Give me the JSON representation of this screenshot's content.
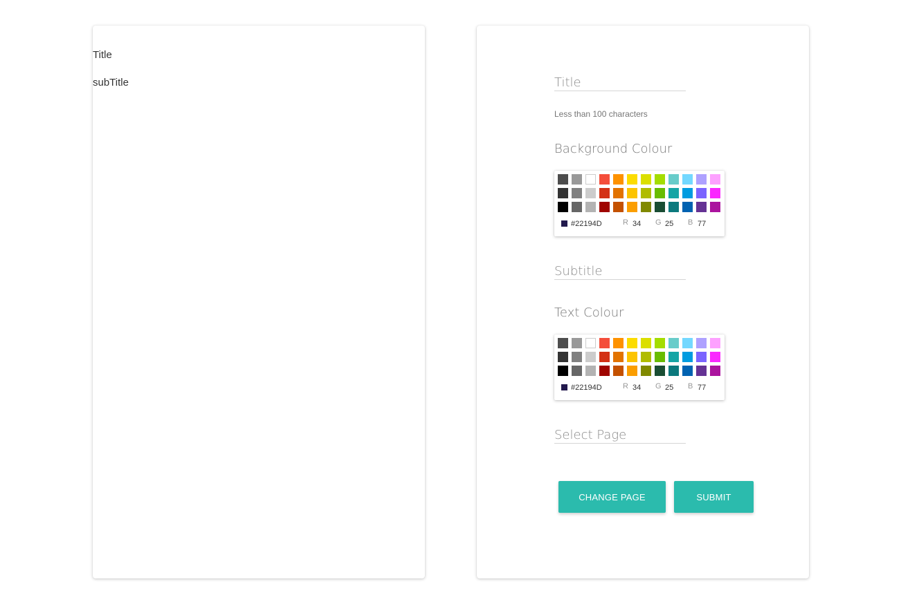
{
  "preview": {
    "title": "Title",
    "subtitle": "subTitle"
  },
  "form": {
    "title_field": {
      "placeholder": "Title",
      "value": ""
    },
    "title_helper": "Less than 100 characters",
    "background_label": "Background Colour",
    "background_picker": {
      "hex": "#22194D",
      "r_label": "R",
      "r": "34",
      "g_label": "G",
      "g": "25",
      "b_label": "B",
      "b": "77",
      "selected_color": "#22194D"
    },
    "subtitle_field": {
      "placeholder": "Subtitle",
      "value": ""
    },
    "text_label": "Text Colour",
    "text_picker": {
      "hex": "#22194D",
      "r_label": "R",
      "r": "34",
      "g_label": "G",
      "g": "25",
      "b_label": "B",
      "b": "77",
      "selected_color": "#22194D"
    },
    "page_field": {
      "placeholder": "Select Page",
      "value": ""
    },
    "change_page_label": "CHANGE PAGE",
    "submit_label": "SUBMIT"
  },
  "swatches": [
    "#4D4D4D",
    "#999999",
    "#FFFFFF",
    "#F44E3B",
    "#FE9200",
    "#FCDC00",
    "#DBDF00",
    "#A4DD00",
    "#68CCCA",
    "#73D8FF",
    "#AEA1FF",
    "#FDA1FF",
    "#333333",
    "#808080",
    "#CCCCCC",
    "#D33115",
    "#E27300",
    "#FCC400",
    "#B0BC00",
    "#68BC00",
    "#16A5A5",
    "#009CE0",
    "#7B64FF",
    "#FA28FF",
    "#000000",
    "#666666",
    "#B3B3B3",
    "#9F0500",
    "#C45100",
    "#FB9E00",
    "#808900",
    "#194D33",
    "#0C797D",
    "#0062B1",
    "#653294",
    "#AB149E"
  ],
  "accent_color": "#2BBBAD"
}
